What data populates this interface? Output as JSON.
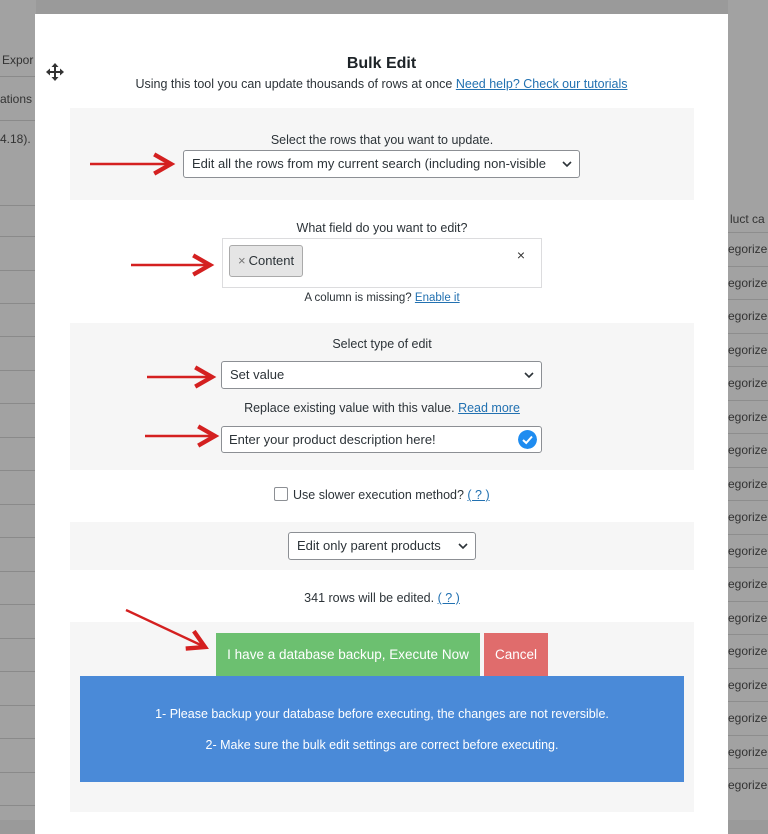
{
  "background": {
    "left_texts": [
      "Expor",
      "ations",
      "4.18)."
    ],
    "right_header": "luct ca",
    "right_cells": [
      "egorize",
      "egorize",
      "egorize",
      "egorize",
      "egorize",
      "egorize",
      "egorize",
      "egorize",
      "egorize",
      "egorize",
      "egorize",
      "egorize",
      "egorize",
      "egorize",
      "egorize",
      "egorize",
      "egorize"
    ]
  },
  "modal": {
    "title": "Bulk Edit",
    "subtitle": "Using this tool you can update thousands of rows at once",
    "help_link": "Need help? Check our tutorials",
    "rows_section": {
      "label": "Select the rows that you want to update.",
      "selected": "Edit all the rows from my current search (including non-visible"
    },
    "field_section": {
      "label": "What field do you want to edit?",
      "tag": "Content",
      "tag_remove": "×",
      "clear": "×",
      "missing_text": "A column is missing?",
      "enable_link": "Enable it"
    },
    "edit_type_section": {
      "label": "Select type of edit",
      "selected": "Set value",
      "hint": "Replace existing value with this value.",
      "read_more": "Read more",
      "value": "Enter your product description here!"
    },
    "slower": {
      "label": "Use slower execution method?",
      "help": "( ? )"
    },
    "parent_select": "Edit only parent products",
    "rows_count": "341 rows will be edited.",
    "rows_help": "( ? )",
    "execute_button": "I have a database backup, Execute Now",
    "cancel_button": "Cancel",
    "notice": [
      "1- Please backup your database before executing, the changes are not reversible.",
      "2- Make sure the bulk edit settings are correct before executing."
    ]
  },
  "colors": {
    "execute": "#6cc070",
    "cancel": "#e06c6c",
    "notice": "#4a8ad8",
    "link": "#2271b1",
    "arrow": "#d42020"
  }
}
